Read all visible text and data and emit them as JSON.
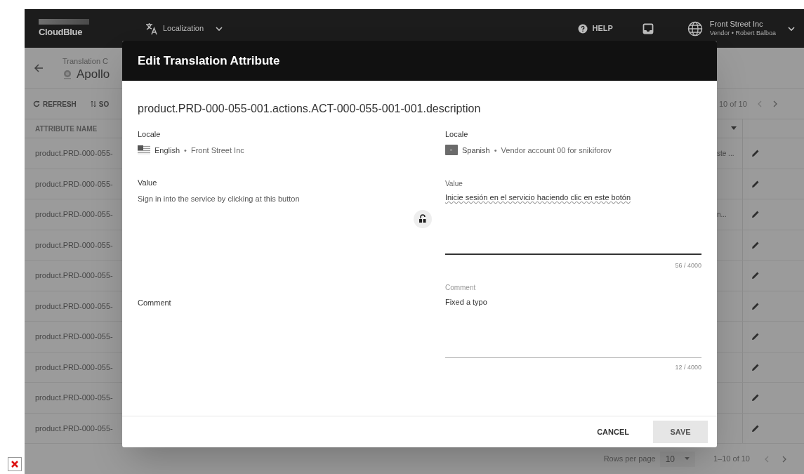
{
  "top_bar": {
    "logo": "CloudBlue",
    "module": "Localization",
    "help": "HELP",
    "account": {
      "name": "Front Street Inc",
      "role": "Vendor • Robert Balboa"
    }
  },
  "page": {
    "breadcrumb": "Translation C",
    "title": "Apollo",
    "toolbar": [
      "REFRESH",
      "SO"
    ],
    "pagination": "10 of 10",
    "table": {
      "columns": [
        "ATTRIBUTE NAME"
      ],
      "rows": [
        {
          "attribute": "product.PRD-000-055-",
          "column_2": "ste ..."
        },
        {
          "attribute": "product.PRD-000-055-"
        },
        {
          "attribute": "product.PRD-000-055-",
          "column_2": "n..."
        },
        {
          "attribute": "product.PRD-000-055-"
        },
        {
          "attribute": "product.PRD-000-055-"
        },
        {
          "attribute": "product.PRD-000-055-"
        },
        {
          "attribute": "product.PRD-000-055-"
        },
        {
          "attribute": "product.PRD-000-055-"
        },
        {
          "attribute": "product.PRD-000-055-"
        },
        {
          "attribute": "product.PRD-000-055-"
        }
      ]
    },
    "footer": {
      "rows_per_page_label": "Rows per page",
      "rows_per_page": "10",
      "range": "1–10 of 10"
    }
  },
  "dialog": {
    "title": "Edit Translation Attribute",
    "attribute_key": "product.PRD-000-055-001.actions.ACT-000-055-001-001.description",
    "source": {
      "locale_label": "Locale",
      "language": "English",
      "separator": "•",
      "account": "Front Street Inc",
      "value_label": "Value",
      "value": "Sign in into the service by clicking at this button",
      "comment_label": "Comment"
    },
    "target": {
      "locale_label": "Locale",
      "language": "Spanish",
      "separator": "•",
      "account": "Vendor account 00 for snikiforov",
      "value_label": "Value",
      "value": "Inicie sesión en el servicio haciendo clic en este botón",
      "value_counter": "56 / 4000",
      "comment_label": "Comment",
      "comment": "Fixed a typo",
      "comment_counter": "12 / 4000"
    },
    "buttons": [
      {
        "label": "CANCEL",
        "kind": "text"
      },
      {
        "label": "SAVE",
        "kind": "filled"
      }
    ]
  }
}
